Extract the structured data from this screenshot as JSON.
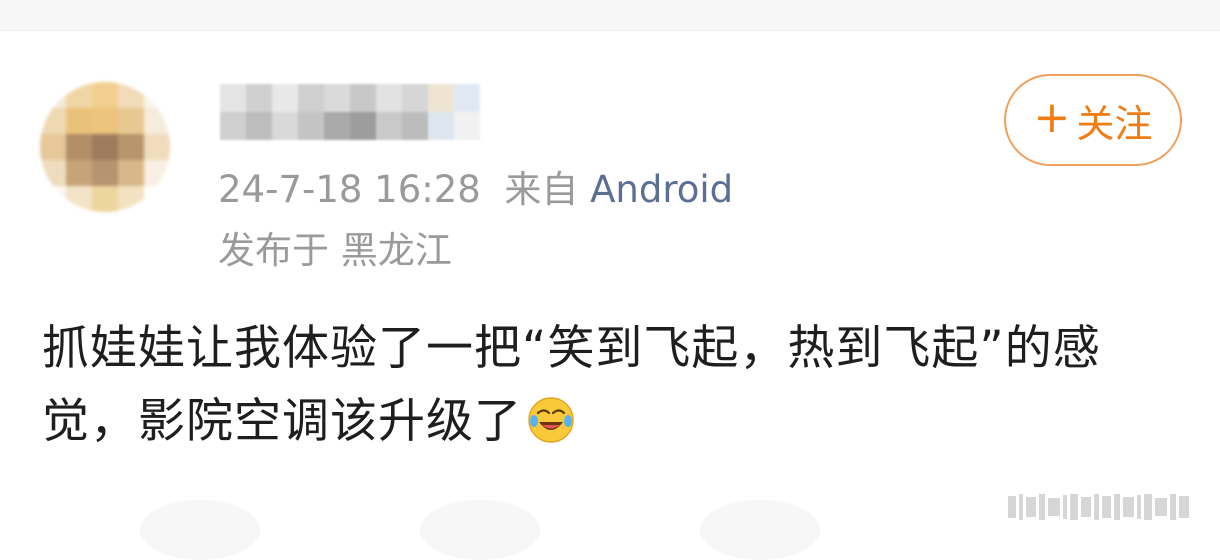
{
  "header": {
    "timestamp": "24-7-18 16:28",
    "source_prefix": "来自",
    "source": "Android",
    "location": "发布于 黑龙江"
  },
  "follow_button": {
    "icon": "plus-icon",
    "label": "关注"
  },
  "post": {
    "text": "抓娃娃让我体验了一把“笑到飞起，热到飞起”的感觉，影院空调该升级了",
    "emoji": "laugh-cry-emoji-icon"
  },
  "colors": {
    "meta_gray": "#9a9a9a",
    "source_blue": "#5b6f95",
    "follow_orange": "#ef7d14",
    "text": "#1e1e1e"
  }
}
